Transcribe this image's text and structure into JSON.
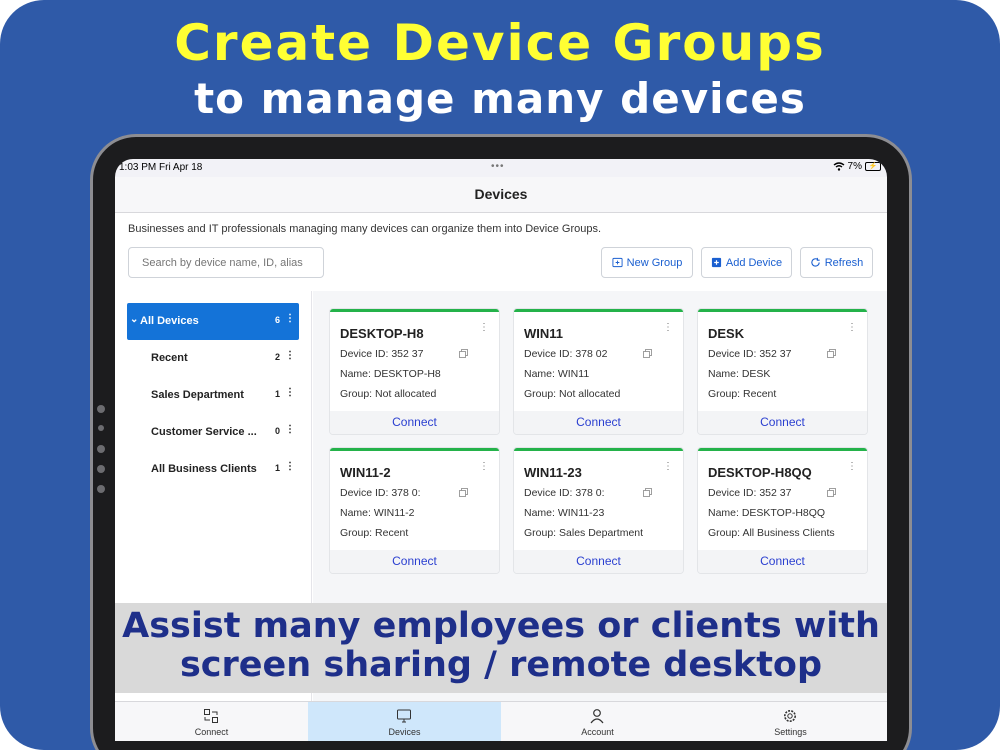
{
  "promo": {
    "headline": "Create Device Groups",
    "subline": "to manage many devices",
    "overlay_line1": "Assist many employees or clients with",
    "overlay_line2": "screen sharing / remote desktop"
  },
  "status_bar": {
    "time": "1:03 PM   Fri Apr 18",
    "dots": "•••",
    "battery": "7%"
  },
  "nav": {
    "title": "Devices"
  },
  "description": "Businesses and IT professionals managing many devices can organize them into Device Groups.",
  "search": {
    "placeholder": "Search by device name, ID, alias",
    "value": ""
  },
  "toolbar": {
    "new_group": "New Group",
    "add_device": "Add Device",
    "refresh": "Refresh"
  },
  "groups": [
    {
      "label": "All Devices",
      "count": "6",
      "selected": true
    },
    {
      "label": "Recent",
      "count": "2"
    },
    {
      "label": "Sales Department",
      "count": "1"
    },
    {
      "label": "Customer Service ...",
      "count": "0"
    },
    {
      "label": "All Business Clients",
      "count": "1"
    }
  ],
  "devices": [
    {
      "name": "DESKTOP-H8",
      "device_id": "Device ID: 352 37",
      "alias": "Name: DESKTOP-H8",
      "group": "Group: Not allocated",
      "connect": "Connect"
    },
    {
      "name": "WIN11",
      "device_id": "Device ID: 378 02",
      "alias": "Name: WIN11",
      "group": "Group: Not allocated",
      "connect": "Connect"
    },
    {
      "name": "DESK",
      "device_id": "Device ID: 352 37",
      "alias": "Name: DESK",
      "group": "Group: Recent",
      "connect": "Connect"
    },
    {
      "name": "WIN11-2",
      "device_id": "Device ID: 378 0:",
      "alias": "Name: WIN11-2",
      "group": "Group: Recent",
      "connect": "Connect"
    },
    {
      "name": "WIN11-23",
      "device_id": "Device ID: 378 0:",
      "alias": "Name: WIN11-23",
      "group": "Group: Sales Department",
      "connect": "Connect"
    },
    {
      "name": "DESKTOP-H8QQ",
      "device_id": "Device ID: 352 37",
      "alias": "Name: DESKTOP-H8QQ",
      "group": "Group: All Business Clients",
      "connect": "Connect"
    }
  ],
  "tabs": [
    {
      "label": "Connect",
      "icon": "connect-icon"
    },
    {
      "label": "Devices",
      "icon": "monitor-icon",
      "selected": true
    },
    {
      "label": "Account",
      "icon": "person-icon"
    },
    {
      "label": "Settings",
      "icon": "gear-icon"
    }
  ],
  "colors": {
    "background": "#2f5aa8",
    "headline": "#ffff33",
    "accent": "#1473d8",
    "online": "#24b24a",
    "overlay_text": "#1e2f8a"
  }
}
